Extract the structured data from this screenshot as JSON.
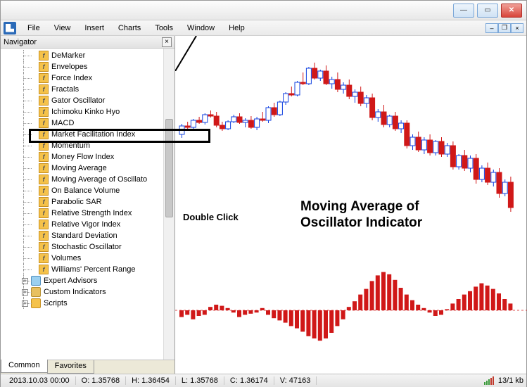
{
  "menu": {
    "items": [
      "File",
      "View",
      "Insert",
      "Charts",
      "Tools",
      "Window",
      "Help"
    ]
  },
  "navigator": {
    "title": "Navigator",
    "indicators": [
      "DeMarker",
      "Envelopes",
      "Force Index",
      "Fractals",
      "Gator Oscillator",
      "Ichimoku Kinko Hyo",
      "MACD",
      "Market Facilitation Index",
      "Momentum",
      "Money Flow Index",
      "Moving Average",
      "Moving Average of Oscillato",
      "On Balance Volume",
      "Parabolic SAR",
      "Relative Strength Index",
      "Relative Vigor Index",
      "Standard Deviation",
      "Stochastic Oscillator",
      "Volumes",
      "Williams' Percent Range"
    ],
    "groups": [
      "Expert Advisors",
      "Custom Indicators",
      "Scripts"
    ],
    "tabs": {
      "common": "Common",
      "favorites": "Favorites"
    }
  },
  "annotations": {
    "double_click": "Double Click",
    "main_line1": "Moving Average of",
    "main_line2": "Oscillator Indicator"
  },
  "status": {
    "datetime": "2013.10.03 00:00",
    "open": "O: 1.35768",
    "high": "H: 1.36454",
    "low": "L: 1.35768",
    "close": "C: 1.36174",
    "volume": "V: 47163",
    "transfer": "13/1 kb"
  },
  "chart_data": {
    "type": "candlestick+histogram",
    "candles_note": "approximate OHLC candlestick series, blank digits unknown from pixels",
    "oscillator": [
      -6,
      -4,
      -8,
      -5,
      -4,
      3,
      5,
      4,
      2,
      -2,
      -6,
      -4,
      -3,
      -2,
      2,
      -4,
      -7,
      -9,
      -11,
      -14,
      -16,
      -19,
      -23,
      -25,
      -27,
      -25,
      -20,
      -14,
      -8,
      3,
      8,
      14,
      19,
      26,
      31,
      34,
      32,
      27,
      20,
      14,
      9,
      5,
      2,
      -2,
      -5,
      -4,
      1,
      6,
      10,
      14,
      17,
      21,
      24,
      22,
      19,
      15,
      10,
      6
    ],
    "colors": {
      "up": "#1040e0",
      "down": "#d01818",
      "osc": "#d01818"
    }
  }
}
